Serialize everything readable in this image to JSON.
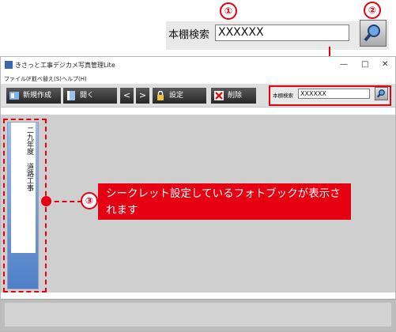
{
  "zoom_callout": {
    "marker_1": "①",
    "marker_2": "②",
    "label": "本棚検索",
    "value": "XXXXXX"
  },
  "window": {
    "title": "きさっと工事デジカメ写真管理Lite",
    "controls": {
      "minimize": "—",
      "maximize": "□",
      "close": "✕"
    },
    "menu": [
      "ファイル(F)",
      "並べ替え(S)",
      "ヘルプ(H)"
    ],
    "toolbar": {
      "new_label": "新規作成",
      "open_label": "開く",
      "prev_label": "<",
      "next_label": ">",
      "settings_label": "設定",
      "delete_label": "削除",
      "search_label": "本棚検索",
      "search_value": "XXXXXX"
    }
  },
  "bookshelf": {
    "book_title": "二九年度 道路工事"
  },
  "annotation": {
    "marker_3": "③",
    "text": "シークレット設定しているフォトブックが表示されます"
  },
  "colors": {
    "accent": "#e50012",
    "toolbar_button": "#3a3a3a",
    "book": "#6f96d6"
  }
}
